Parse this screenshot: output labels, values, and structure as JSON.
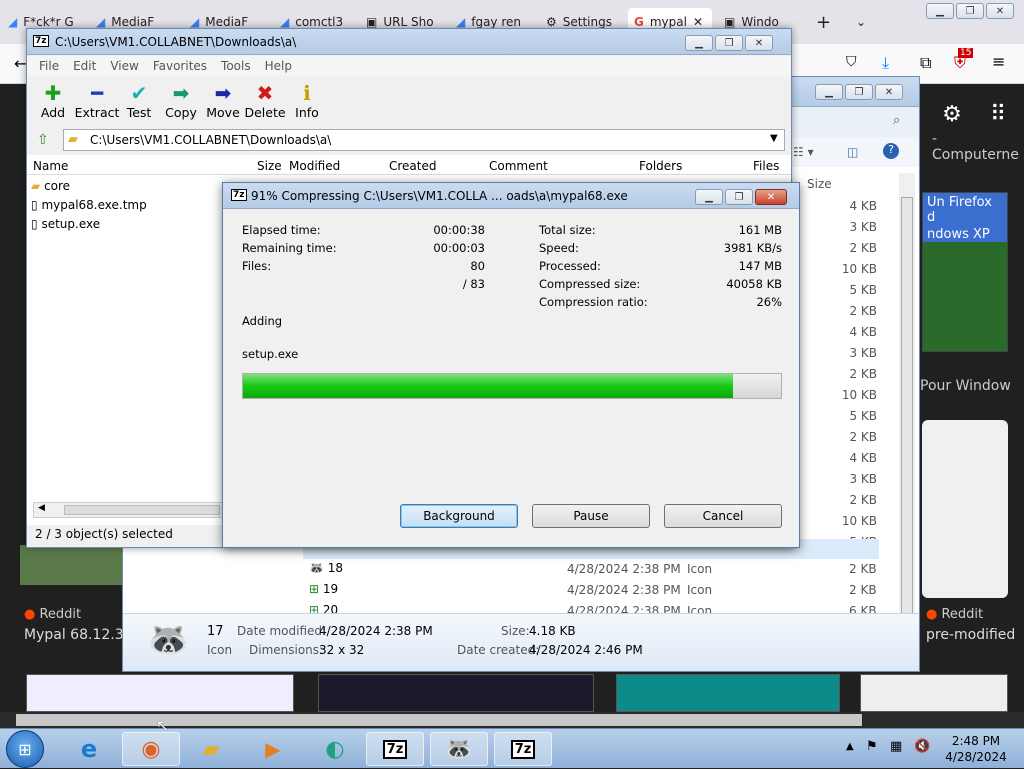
{
  "browser": {
    "tabs": [
      "F*ck*r G",
      "MediaF",
      "MediaF",
      "comctl3",
      "URL Sho",
      "fgay ren",
      "Settings",
      "mypal",
      "Windo"
    ],
    "badge": "15"
  },
  "web": {
    "left_source": "Reddit",
    "left_title": "Mypal 68.12.3/i",
    "right_title_top": "- Computerne",
    "right_card_text1": "Un Firefox d",
    "right_card_text2": "ndows XP",
    "right_pour": "Pour Window",
    "right_source": "Reddit",
    "right_title": "pre-modified"
  },
  "explorer": {
    "size_header": "Size",
    "sizes": [
      "4 KB",
      "3 KB",
      "2 KB",
      "10 KB",
      "5 KB",
      "2 KB",
      "4 KB",
      "3 KB",
      "2 KB",
      "10 KB",
      "5 KB",
      "2 KB",
      "4 KB",
      "3 KB",
      "2 KB",
      "10 KB",
      "5 KB"
    ],
    "rows": [
      {
        "name": "18",
        "date": "4/28/2024 2:38 PM",
        "type": "Icon",
        "size": "2 KB"
      },
      {
        "name": "19",
        "date": "4/28/2024 2:38 PM",
        "type": "Icon",
        "size": "2 KB"
      },
      {
        "name": "20",
        "date": "4/28/2024 2:38 PM",
        "type": "Icon",
        "size": "6 KB"
      }
    ],
    "details": {
      "name": "17",
      "type": "Icon",
      "modified_label": "Date modified:",
      "modified": "4/28/2024 2:38 PM",
      "dim_label": "Dimensions:",
      "dim": "32 x 32",
      "size_label": "Size:",
      "size": "4.18 KB",
      "created_label": "Date created:",
      "created": "4/28/2024 2:46 PM"
    }
  },
  "zip": {
    "title": "C:\\Users\\VM1.COLLABNET\\Downloads\\a\\",
    "menu": [
      "File",
      "Edit",
      "View",
      "Favorites",
      "Tools",
      "Help"
    ],
    "toolbar": [
      "Add",
      "Extract",
      "Test",
      "Copy",
      "Move",
      "Delete",
      "Info"
    ],
    "path": "C:\\Users\\VM1.COLLABNET\\Downloads\\a\\",
    "columns": [
      "Name",
      "Size",
      "Modified",
      "Created",
      "Comment",
      "Folders",
      "Files"
    ],
    "files": [
      "core",
      "mypal68.exe.tmp",
      "setup.exe"
    ],
    "status": "2 / 3 object(s) selected"
  },
  "dialog": {
    "title": "91% Compressing C:\\Users\\VM1.COLLA ... oads\\a\\mypal68.exe",
    "elapsed_label": "Elapsed time:",
    "elapsed": "00:00:38",
    "remaining_label": "Remaining time:",
    "remaining": "00:00:03",
    "files_label": "Files:",
    "files": "80",
    "files_total": "/ 83",
    "total_label": "Total size:",
    "total": "161 MB",
    "speed_label": "Speed:",
    "speed": "3981 KB/s",
    "processed_label": "Processed:",
    "processed": "147 MB",
    "compressed_label": "Compressed size:",
    "compressed": "40058 KB",
    "ratio_label": "Compression ratio:",
    "ratio": "26%",
    "action": "Adding",
    "current_file": "setup.exe",
    "progress": 0.91,
    "buttons": {
      "background": "Background",
      "pause": "Pause",
      "cancel": "Cancel"
    }
  },
  "taskbar": {
    "time": "2:48 PM",
    "date": "4/28/2024"
  },
  "colors": {
    "progress": "#14c814",
    "aero_title": "#c9dcf1",
    "taskbar": "#8eb0d8"
  }
}
